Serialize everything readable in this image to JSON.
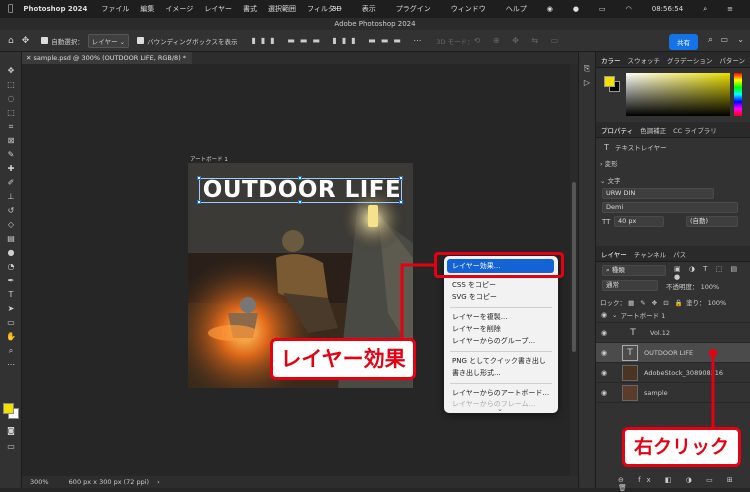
{
  "menubar": {
    "app_name": "Photoshop 2024",
    "items": [
      "ファイル",
      "編集",
      "イメージ",
      "レイヤー",
      "書式",
      "選択範囲",
      "フィルター"
    ],
    "right_items": [
      "3D",
      "表示",
      "プラグイン",
      "ウィンドウ",
      "ヘルプ"
    ],
    "clock": "08:56:54"
  },
  "window": {
    "title": "Adobe Photoshop 2024"
  },
  "options": {
    "auto_select_label": "自動選択：",
    "auto_select_value": "レイヤー",
    "bounding_box_label": "バウンディングボックスを表示",
    "mode_3d": "3D モード：",
    "share_label": "共有"
  },
  "document": {
    "tab_title": "sample.psd @ 300% (OUTDOOR LIFE, RGB/8) *",
    "artboard_label": "アートボード 1",
    "headline_text": "OUTDOOR LIFE"
  },
  "status": {
    "zoom": "300%",
    "info": "600 px x 300 px (72 ppi)"
  },
  "color_panel": {
    "tabs": [
      "カラー",
      "スウォッチ",
      "グラデーション",
      "パターン"
    ],
    "accent": "#f5e100"
  },
  "properties_panel": {
    "tabs": [
      "プロパティ",
      "色調補正",
      "CC ライブラリ"
    ],
    "layer_kind": "テキストレイヤー",
    "transform_label": "変形",
    "character_label": "文字",
    "font_family": "URW DIN",
    "font_style": "Demi",
    "font_size": "40 px",
    "leading": "(自動)"
  },
  "layers_panel": {
    "tabs": [
      "レイヤー",
      "チャンネル",
      "パス"
    ],
    "filter_kind": "種類",
    "blend_mode": "通常",
    "opacity_label": "不透明度：",
    "opacity_value": "100%",
    "lock_label": "ロック：",
    "fill_label": "塗り：",
    "fill_value": "100%",
    "artboard_name": "アートボード 1",
    "layers": [
      {
        "name": "Vol.12"
      },
      {
        "name": "OUTDOOR LIFE"
      },
      {
        "name": "AdobeStock_308908216"
      },
      {
        "name": "sample"
      }
    ]
  },
  "context_menu": {
    "items": [
      "レイヤー効果...",
      "CSS をコピー",
      "SVG をコピー",
      "レイヤーを複製...",
      "レイヤーを削除",
      "レイヤーからのグループ...",
      "PNG としてクイック書き出し",
      "書き出し形式...",
      "レイヤーからのアートボード...",
      "レイヤーからのフレーム..."
    ],
    "highlight_color": "#1463d6"
  },
  "annotations": {
    "layer_effects_callout": "レイヤー効果",
    "right_click_callout": "右クリック",
    "color": "#e60012"
  }
}
